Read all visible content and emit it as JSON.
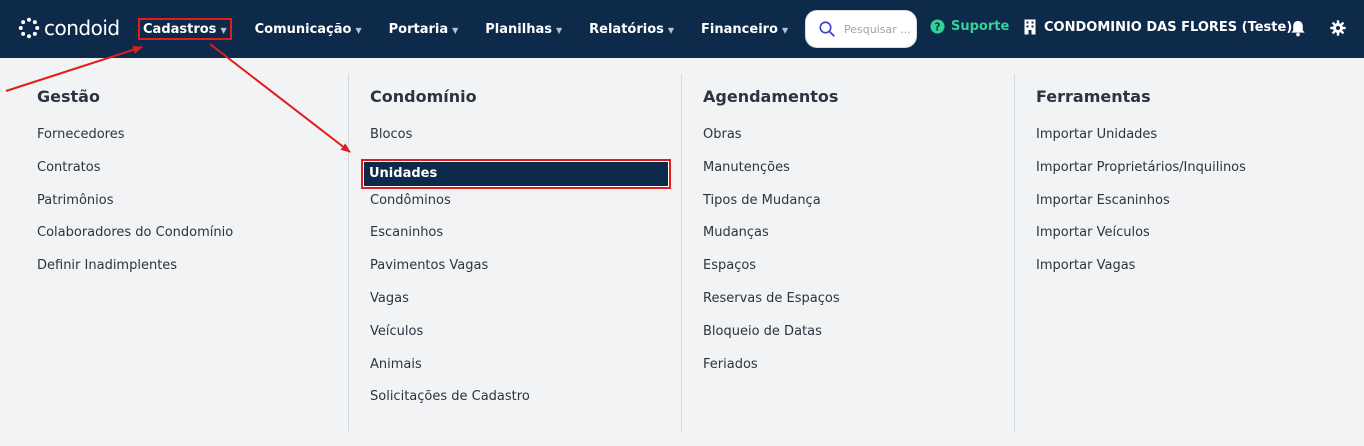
{
  "brand": {
    "name": "condoid"
  },
  "nav": {
    "items": [
      {
        "label": "Cadastros",
        "active": true
      },
      {
        "label": "Comunicação",
        "active": false
      },
      {
        "label": "Portaria",
        "active": false
      },
      {
        "label": "Planilhas",
        "active": false
      },
      {
        "label": "Relatórios",
        "active": false
      },
      {
        "label": "Financeiro",
        "active": false
      }
    ]
  },
  "search": {
    "placeholder": "Pesquisar ..."
  },
  "support": {
    "label": "Suporte"
  },
  "condominium": {
    "label": "CONDOMINIO DAS FLORES (Teste)"
  },
  "icons": {
    "search": "search-icon",
    "support": "help-circle-icon",
    "condominium": "building-icon",
    "notifications": "bell-icon",
    "settings": "gear-icon"
  },
  "colors": {
    "topbar": "#0e2a4a",
    "support": "#32d39a",
    "highlight": "#e11d1d"
  },
  "menu": {
    "columns": [
      {
        "title": "Gestão",
        "items": [
          "Fornecedores",
          "Contratos",
          "Patrimônios",
          "Colaboradores do Condomínio",
          "Definir Inadimplentes"
        ]
      },
      {
        "title": "Condomínio",
        "items": [
          "Blocos",
          "Unidades",
          "Condôminos",
          "Escaninhos",
          "Pavimentos Vagas",
          "Vagas",
          "Veículos",
          "Animais",
          "Solicitações de Cadastro"
        ],
        "selected": "Unidades"
      },
      {
        "title": "Agendamentos",
        "items": [
          "Obras",
          "Manutenções",
          "Tipos de Mudança",
          "Mudanças",
          "Espaços",
          "Reservas de Espaços",
          "Bloqueio de Datas",
          "Feriados"
        ]
      },
      {
        "title": "Ferramentas",
        "items": [
          "Importar Unidades",
          "Importar Proprietários/Inquilinos",
          "Importar Escaninhos",
          "Importar Veículos",
          "Importar Vagas"
        ]
      }
    ]
  }
}
